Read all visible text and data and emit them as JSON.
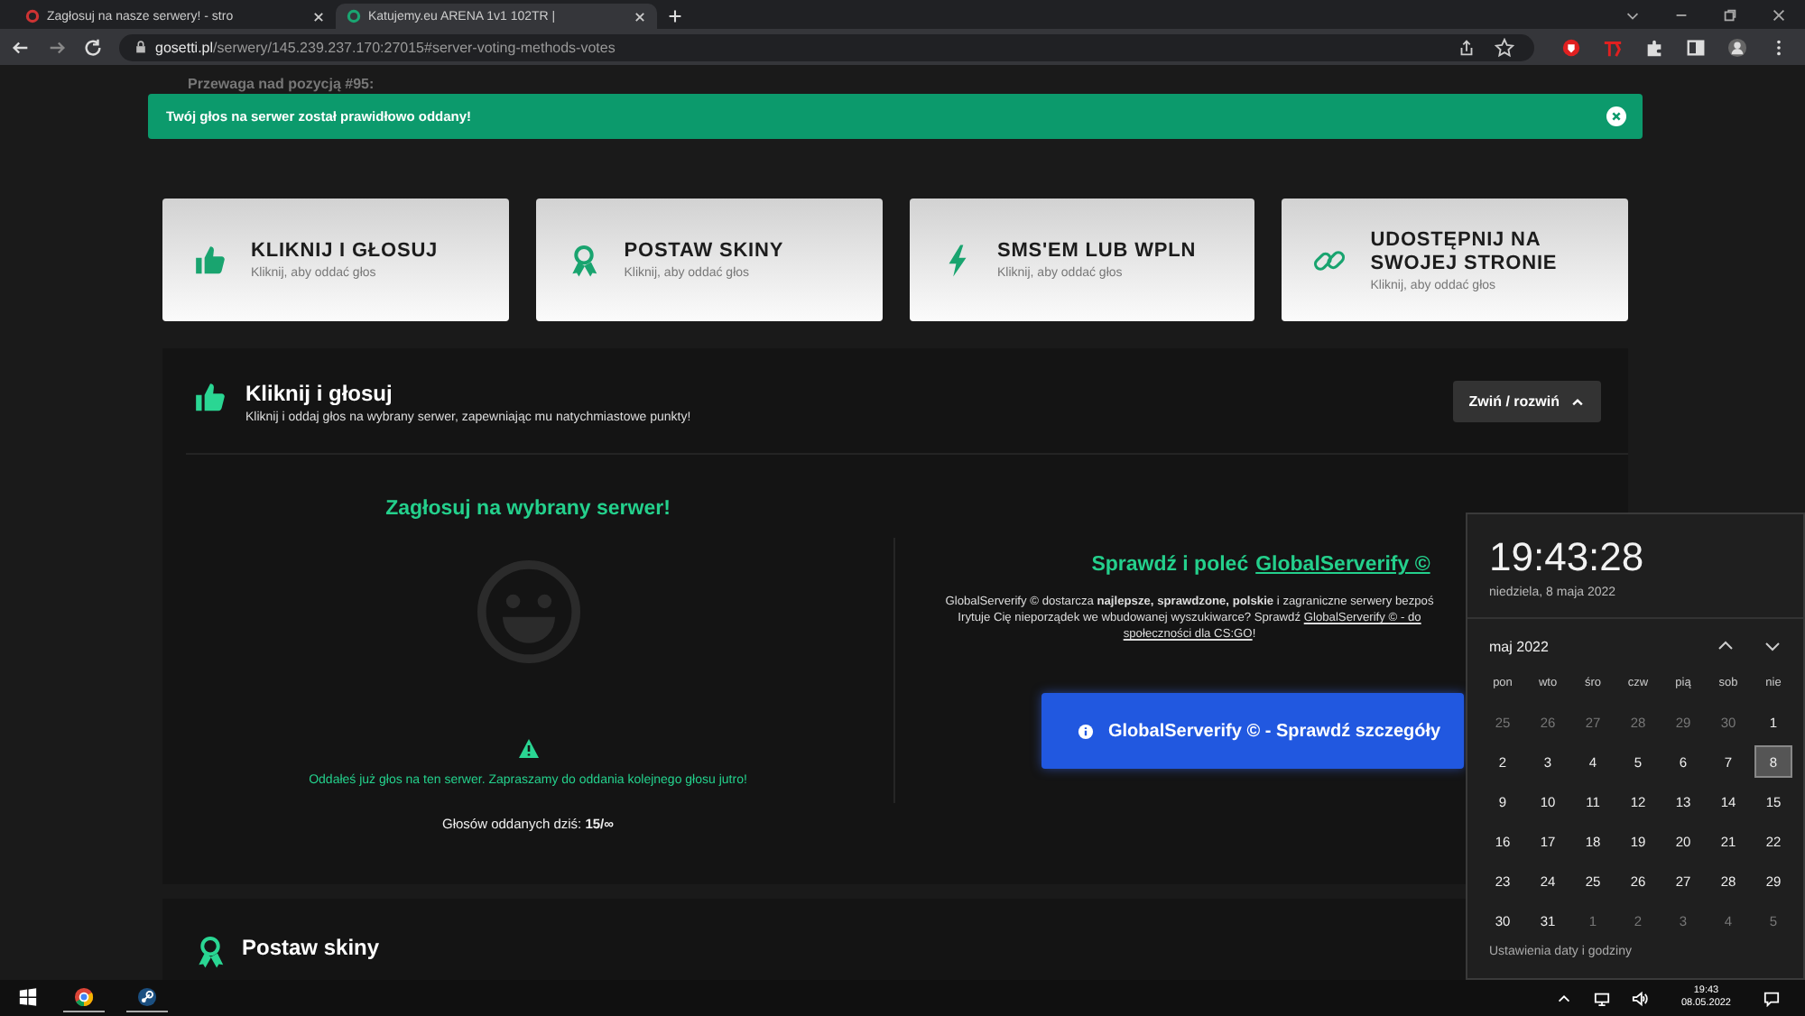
{
  "browser": {
    "tabs": [
      {
        "title": "Zagłosuj na nasze serwery! - stro",
        "selected": false
      },
      {
        "title": "Katujemy.eu ARENA 1v1 102TR |",
        "selected": true
      }
    ],
    "url_domain": "gosetti.pl",
    "url_path": "/serwery/145.239.237.170:27015#server-voting-methods-votes"
  },
  "page": {
    "top_text": "Przewaga nad pozycją #95:",
    "toast": "Twój głos na serwer został prawidłowo oddany!",
    "cards": [
      {
        "kind": "thumb",
        "title": "KLIKNIJ I GŁOSUJ",
        "subtitle": "Kliknij, aby oddać głos"
      },
      {
        "kind": "award",
        "title": "POSTAW SKINY",
        "subtitle": "Kliknij, aby oddać głos"
      },
      {
        "kind": "bolt",
        "title": "SMS'EM LUB WPLN",
        "subtitle": "Kliknij, aby oddać głos"
      },
      {
        "kind": "link",
        "title": "UDOSTĘPNIJ NA SWOJEJ STRONIE",
        "subtitle": "Kliknij, aby oddać głos"
      }
    ],
    "section": {
      "kind": "thumb",
      "title": "Kliknij i głosuj",
      "subtitle": "Kliknij i oddaj głos na wybrany serwer, zapewniając mu natychmiastowe punkty!",
      "toggle": "Zwiń / rozwiń",
      "vote_title": "Zagłosuj na wybrany serwer!",
      "notice": "Oddałeś już głos na ten serwer. Zapraszamy do oddania kolejnego głosu jutro!",
      "count": "Głosów oddanych dziś: **15/∞**",
      "promo_title": "Sprawdź i poleć",
      "promo_link": "GlobalServerify ©",
      "paragraph": [
        [
          {
            "text": "GlobalServerify © dostarcza **najlepsze, sprawdzone, polskie** i zagraniczne serwery bezpoś",
            "kind": "text"
          }
        ],
        [
          {
            "text": "Irytuje Cię nieporządek we wbudowanej wyszukiwarce? Sprawdź ",
            "kind": "text"
          },
          {
            "text": "GlobalServerify © - do",
            "kind": "link"
          }
        ],
        [
          {
            "text": "społeczności dla CS:GO",
            "kind": "link"
          },
          {
            "text": "!",
            "kind": "text"
          }
        ]
      ],
      "promo_button": "GlobalServerify © - Sprawdź szczegóły"
    },
    "next_section": {
      "kind": "award",
      "title": "Postaw skiny"
    }
  },
  "calendar": {
    "time": "19:43:28",
    "date": "niedziela, 8 maja 2022",
    "month": "maj 2022",
    "weekdays": [
      "pon",
      "wto",
      "śro",
      "czw",
      "pią",
      "sob",
      "nie"
    ],
    "days": [
      {
        "day": "25",
        "muted": true,
        "selected": false
      },
      {
        "day": "26",
        "muted": true,
        "selected": false
      },
      {
        "day": "27",
        "muted": true,
        "selected": false
      },
      {
        "day": "28",
        "muted": true,
        "selected": false
      },
      {
        "day": "29",
        "muted": true,
        "selected": false
      },
      {
        "day": "30",
        "muted": true,
        "selected": false
      },
      {
        "day": "1",
        "muted": false,
        "selected": false
      },
      {
        "day": "2",
        "muted": false,
        "selected": false
      },
      {
        "day": "3",
        "muted": false,
        "selected": false
      },
      {
        "day": "4",
        "muted": false,
        "selected": false
      },
      {
        "day": "5",
        "muted": false,
        "selected": false
      },
      {
        "day": "6",
        "muted": false,
        "selected": false
      },
      {
        "day": "7",
        "muted": false,
        "selected": false
      },
      {
        "day": "8",
        "muted": false,
        "selected": true
      },
      {
        "day": "9",
        "muted": false,
        "selected": false
      },
      {
        "day": "10",
        "muted": false,
        "selected": false
      },
      {
        "day": "11",
        "muted": false,
        "selected": false
      },
      {
        "day": "12",
        "muted": false,
        "selected": false
      },
      {
        "day": "13",
        "muted": false,
        "selected": false
      },
      {
        "day": "14",
        "muted": false,
        "selected": false
      },
      {
        "day": "15",
        "muted": false,
        "selected": false
      },
      {
        "day": "16",
        "muted": false,
        "selected": false
      },
      {
        "day": "17",
        "muted": false,
        "selected": false
      },
      {
        "day": "18",
        "muted": false,
        "selected": false
      },
      {
        "day": "19",
        "muted": false,
        "selected": false
      },
      {
        "day": "20",
        "muted": false,
        "selected": false
      },
      {
        "day": "21",
        "muted": false,
        "selected": false
      },
      {
        "day": "22",
        "muted": false,
        "selected": false
      },
      {
        "day": "23",
        "muted": false,
        "selected": false
      },
      {
        "day": "24",
        "muted": false,
        "selected": false
      },
      {
        "day": "25",
        "muted": false,
        "selected": false
      },
      {
        "day": "26",
        "muted": false,
        "selected": false
      },
      {
        "day": "27",
        "muted": false,
        "selected": false
      },
      {
        "day": "28",
        "muted": false,
        "selected": false
      },
      {
        "day": "29",
        "muted": false,
        "selected": false
      },
      {
        "day": "30",
        "muted": false,
        "selected": false
      },
      {
        "day": "31",
        "muted": false,
        "selected": false
      },
      {
        "day": "1",
        "muted": true,
        "selected": false
      },
      {
        "day": "2",
        "muted": true,
        "selected": false
      },
      {
        "day": "3",
        "muted": true,
        "selected": false
      },
      {
        "day": "4",
        "muted": true,
        "selected": false
      },
      {
        "day": "5",
        "muted": true,
        "selected": false
      }
    ],
    "settings_link": "Ustawienia daty i godziny"
  },
  "taskbar": {
    "time": "19:43",
    "date": "08.05.2022"
  }
}
